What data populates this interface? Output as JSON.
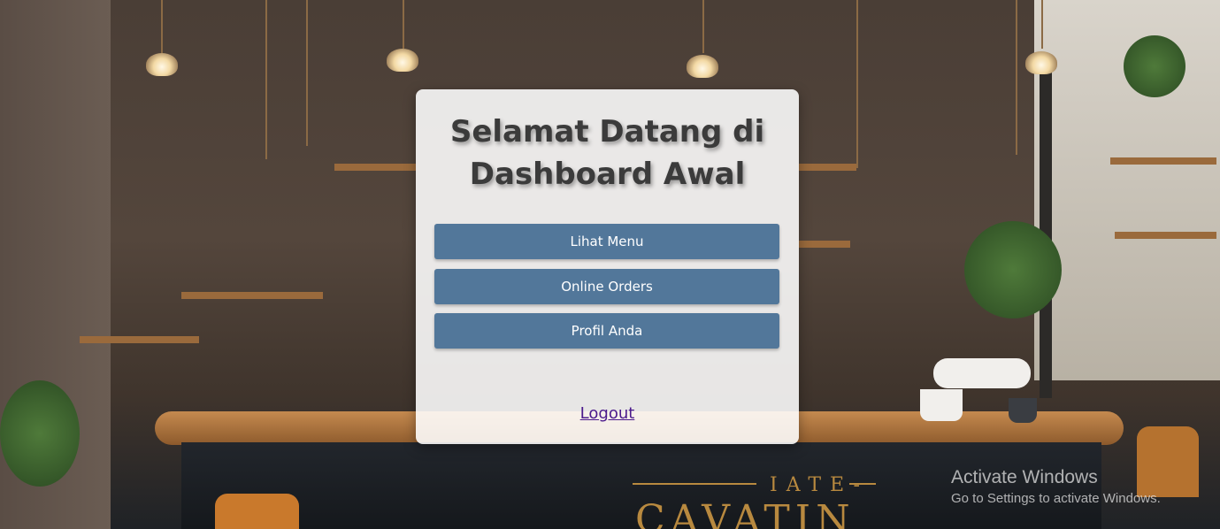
{
  "dashboard": {
    "title_line1": "Selamat Datang di",
    "title_line2": "Dashboard Awal",
    "buttons": [
      {
        "label": "Lihat Menu"
      },
      {
        "label": "Online Orders"
      },
      {
        "label": "Profil Anda"
      }
    ],
    "logout_label": "Logout"
  },
  "background": {
    "sign_text": "IATE-",
    "sign_text_large": "CAVATIN"
  },
  "watermark": {
    "title": "Activate Windows",
    "subtitle": "Go to Settings to activate Windows."
  },
  "colors": {
    "button_bg": "#52779a",
    "button_text": "#ffffff",
    "link": "#4b1a8c",
    "card_bg": "#ffffff"
  }
}
